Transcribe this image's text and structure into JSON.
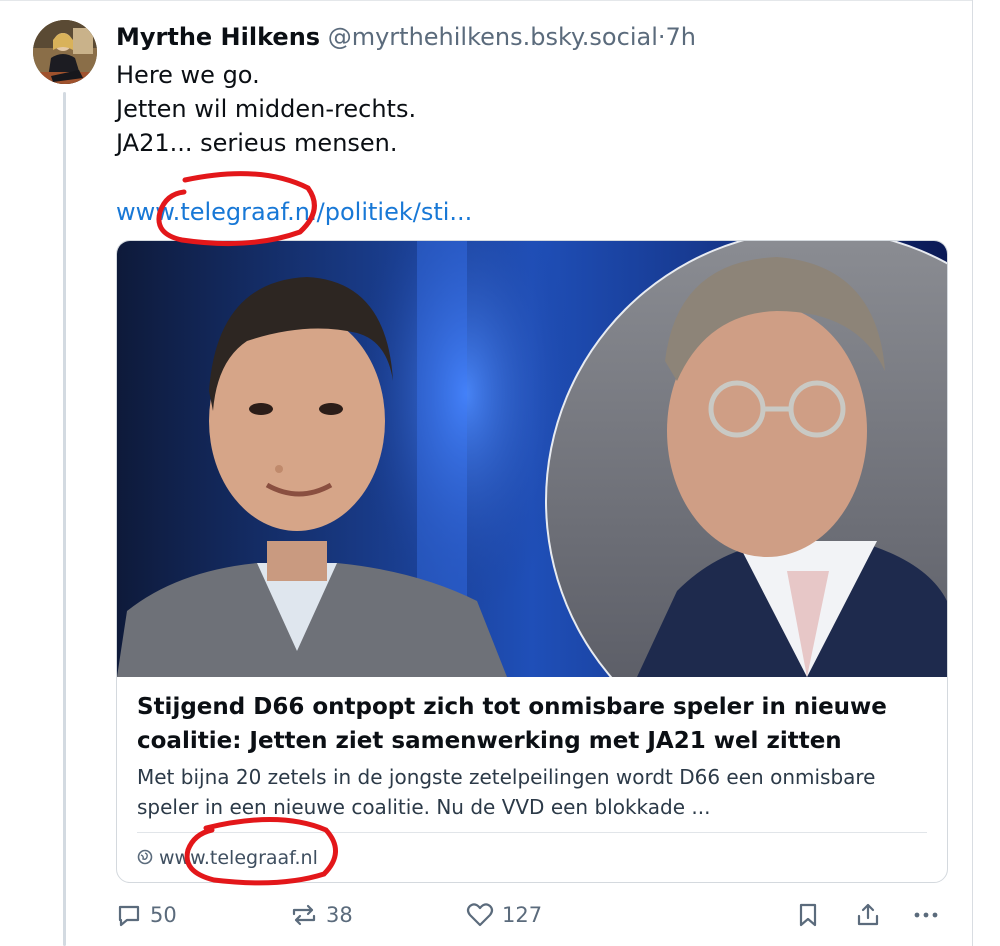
{
  "post": {
    "author_name": "Myrthe Hilkens",
    "handle": "@myrthehilkens.bsky.social",
    "separator": "·",
    "time": "7h",
    "text_lines": [
      "Here we go.",
      "Jetten wil midden-rechts.",
      "JA21... serieus mensen."
    ],
    "link_text": "www.telegraaf.nl/politiek/sti..."
  },
  "link_card": {
    "title": "Stijgend D66 ontpopt zich tot onmisbare speler in nieuwe coalitie: Jetten ziet samenwerking met JA21 wel zitten",
    "description": "Met bijna 20 zetels in de jongste zetelpeilingen wordt D66 een onmisbare speler in een nieuwe coalitie. Nu de VVD een blokkade ...",
    "domain": "www.telegraaf.nl"
  },
  "actions": {
    "reply_count": "50",
    "repost_count": "38",
    "like_count": "127",
    "icons": [
      "reply-icon",
      "repost-icon",
      "like-icon",
      "bookmark-icon",
      "share-icon",
      "more-icon"
    ]
  },
  "colors": {
    "link": "#1878d6",
    "annotation_red": "#e3171a",
    "muted_text": "#5b6b7c"
  }
}
